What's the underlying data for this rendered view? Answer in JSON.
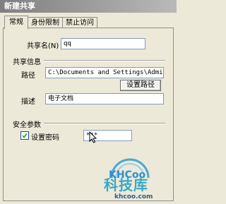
{
  "window": {
    "title": "新建共享"
  },
  "tabs": [
    {
      "label": "常规"
    },
    {
      "label": "身份限制"
    },
    {
      "label": "禁止访问"
    }
  ],
  "share_name": {
    "label": "共享名(N)",
    "value": "qq"
  },
  "share_info": {
    "heading": "共享信息",
    "path_label": "路径",
    "path_value": "C:\\Documents and Settings\\Administrat",
    "set_path_button": "设置路径",
    "description_label": "描述",
    "description_value": "电子文档"
  },
  "security": {
    "heading": "安全参数",
    "set_password_checked": true,
    "set_password_label": "设置密码",
    "password_value": "***"
  },
  "watermark": {
    "logo_text": "KHCoo",
    "big_text": "科技库",
    "url": "khcoo.com"
  }
}
